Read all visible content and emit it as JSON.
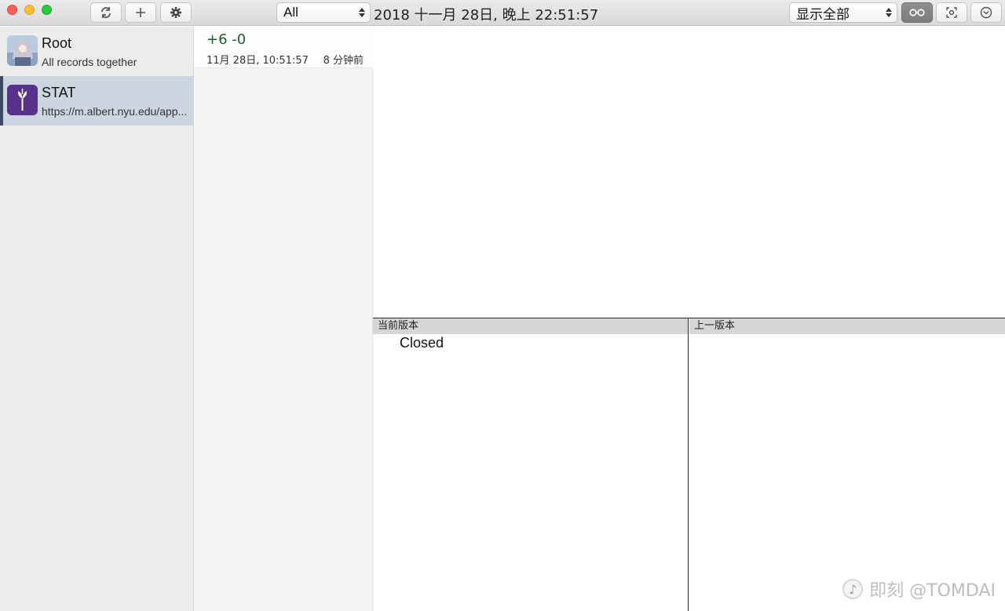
{
  "toolbar": {
    "filter_select": "All",
    "datetime": "2018 十一月 28日, 晚上 22:51:57",
    "view_select": "显示全部"
  },
  "sidebar": {
    "sites": [
      {
        "name": "Root",
        "subtitle": "All records together"
      },
      {
        "name": "STAT",
        "subtitle": "https://m.albert.nyu.edu/app..."
      }
    ]
  },
  "records": [
    {
      "delta": "+6 -0",
      "date": "11月 28日, 10:51:57",
      "ago": "8 分钟前"
    }
  ],
  "diff": {
    "current_header": "当前版本",
    "previous_header": "上一版本",
    "current_content": "Closed",
    "previous_content": ""
  },
  "watermark": "即刻 @TOMDAI",
  "colors": {
    "selected_row": "#cdd6e0",
    "selected_accent": "#3c4a66",
    "delta_green": "#1f5f2f"
  }
}
